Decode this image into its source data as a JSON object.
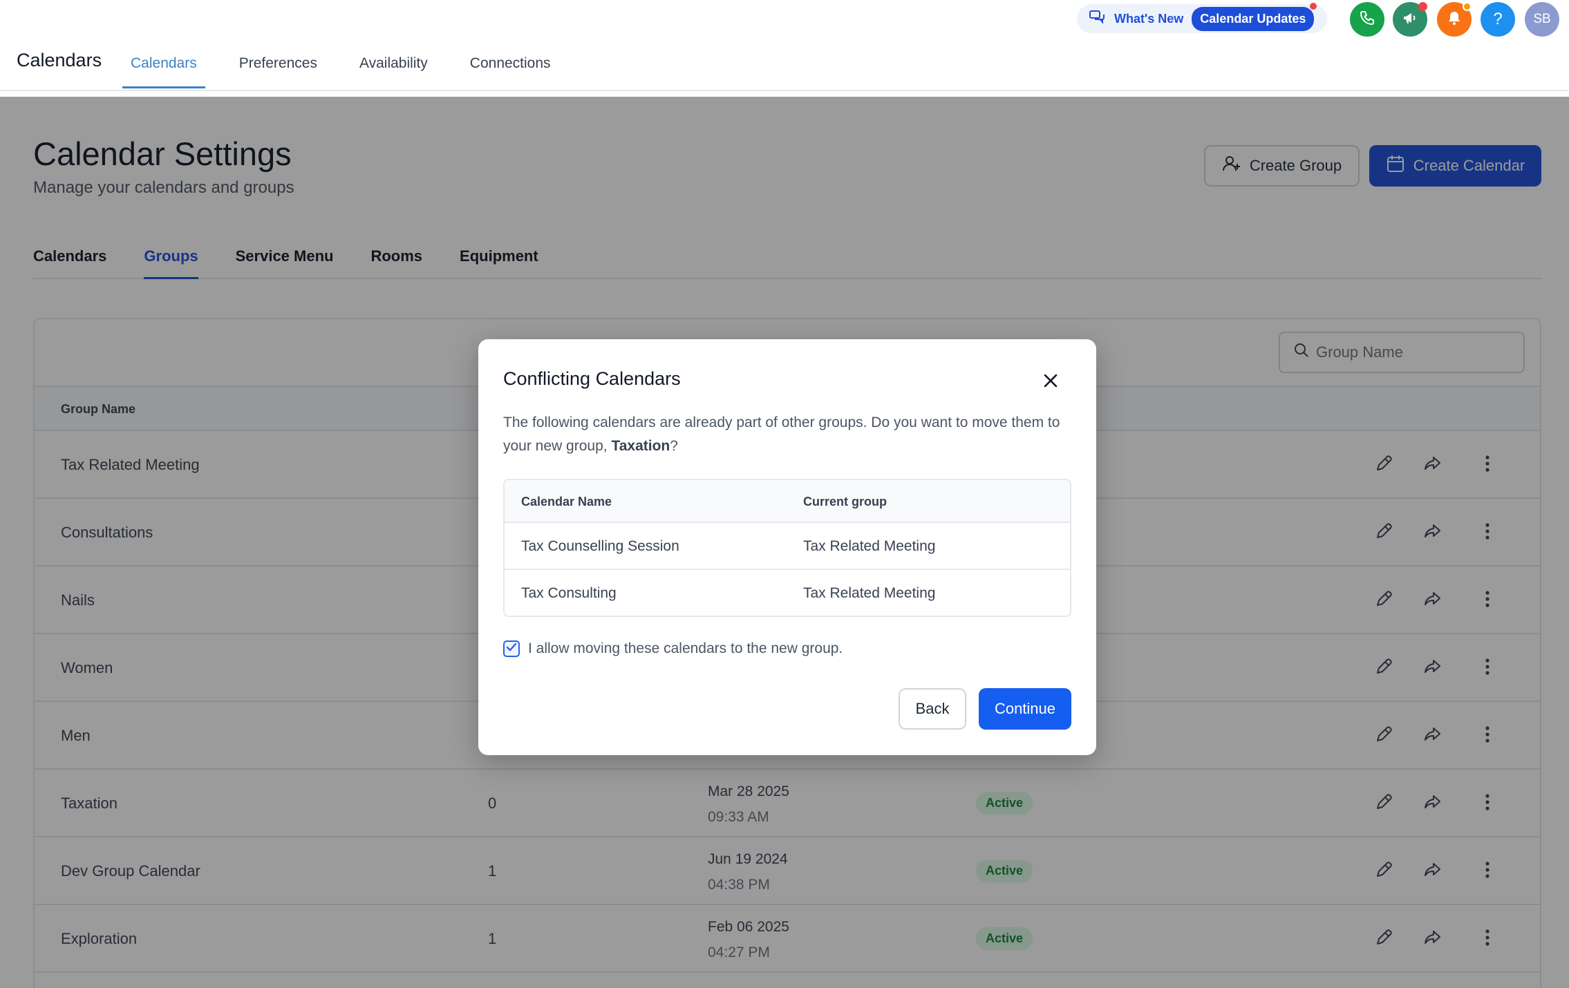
{
  "header": {
    "app_title": "Calendars",
    "nav": [
      {
        "label": "Calendars",
        "active": true
      },
      {
        "label": "Preferences",
        "active": false
      },
      {
        "label": "Availability",
        "active": false
      },
      {
        "label": "Connections",
        "active": false
      }
    ],
    "whats_new_label": "What's New",
    "calendar_updates_label": "Calendar Updates",
    "avatar_initials": "SB",
    "help_label": "?",
    "icons": [
      "chat-icon",
      "phone-icon",
      "megaphone-icon",
      "bell-icon",
      "help-icon"
    ],
    "colors": {
      "phone": "#16a34a",
      "megaphone": "#2f8f6a",
      "bell": "#f97316",
      "help": "#1e90f0",
      "badge_red": "#ef4444",
      "badge_orange": "#f59e0b"
    }
  },
  "page": {
    "title": "Calendar Settings",
    "subtitle": "Manage your calendars and groups",
    "create_group_label": "Create Group",
    "create_calendar_label": "Create Calendar",
    "tabs": [
      {
        "label": "Calendars",
        "active": false
      },
      {
        "label": "Groups",
        "active": true
      },
      {
        "label": "Service Menu",
        "active": false
      },
      {
        "label": "Rooms",
        "active": false
      },
      {
        "label": "Equipment",
        "active": false
      }
    ],
    "search_placeholder": "Group Name",
    "table": {
      "column_group_name": "Group Name",
      "rows": [
        {
          "name": "Tax Related Meeting",
          "count": "",
          "date": "",
          "time": "",
          "status": ""
        },
        {
          "name": "Consultations",
          "count": "",
          "date": "",
          "time": "",
          "status": ""
        },
        {
          "name": "Nails",
          "count": "",
          "date": "",
          "time": "",
          "status": ""
        },
        {
          "name": "Women",
          "count": "",
          "date": "",
          "time": "",
          "status": ""
        },
        {
          "name": "Men",
          "count": "",
          "date": "",
          "time": "",
          "status": ""
        },
        {
          "name": "Taxation",
          "count": "0",
          "date": "Mar 28 2025",
          "time": "09:33 AM",
          "status": "Active"
        },
        {
          "name": "Dev Group Calendar",
          "count": "1",
          "date": "Jun 19 2024",
          "time": "04:38 PM",
          "status": "Active"
        },
        {
          "name": "Exploration",
          "count": "1",
          "date": "Feb 06 2025",
          "time": "04:27 PM",
          "status": "Active"
        }
      ]
    }
  },
  "modal": {
    "title": "Conflicting Calendars",
    "desc_prefix": "The following calendars are already part of other groups. Do you want to move them to your new group, ",
    "group_name": "Taxation",
    "desc_suffix": "?",
    "col_calendar_name": "Calendar Name",
    "col_current_group": "Current group",
    "rows": [
      {
        "calendar": "Tax Counselling Session",
        "group": "Tax Related Meeting"
      },
      {
        "calendar": "Tax Consulting",
        "group": "Tax Related Meeting"
      }
    ],
    "checkbox_label": "I allow moving these calendars to the new group.",
    "checkbox_checked": true,
    "back_label": "Back",
    "continue_label": "Continue"
  }
}
